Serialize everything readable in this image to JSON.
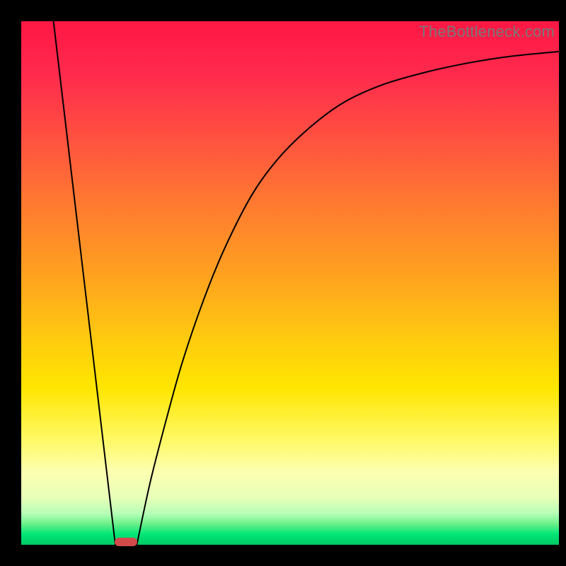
{
  "watermark": "TheBottleneck.com",
  "colors": {
    "background": "#000000",
    "curve": "#000000",
    "marker": "#d24a4a",
    "gradient_top": "#ff1744",
    "gradient_bottom": "#00c864"
  },
  "chart_data": {
    "type": "line",
    "title": "",
    "xlabel": "",
    "ylabel": "",
    "xlim": [
      0,
      1
    ],
    "ylim": [
      0,
      1
    ],
    "annotations": [
      "TheBottleneck.com"
    ],
    "left_segment": {
      "start": {
        "x": 0.06,
        "y": 1.0
      },
      "end": {
        "x": 0.175,
        "y": 0.0
      }
    },
    "right_segment": {
      "points": [
        {
          "x": 0.215,
          "y": 0.0
        },
        {
          "x": 0.24,
          "y": 0.12
        },
        {
          "x": 0.27,
          "y": 0.24
        },
        {
          "x": 0.3,
          "y": 0.35
        },
        {
          "x": 0.34,
          "y": 0.47
        },
        {
          "x": 0.38,
          "y": 0.57
        },
        {
          "x": 0.43,
          "y": 0.67
        },
        {
          "x": 0.48,
          "y": 0.74
        },
        {
          "x": 0.54,
          "y": 0.8
        },
        {
          "x": 0.6,
          "y": 0.845
        },
        {
          "x": 0.67,
          "y": 0.878
        },
        {
          "x": 0.75,
          "y": 0.902
        },
        {
          "x": 0.83,
          "y": 0.92
        },
        {
          "x": 0.91,
          "y": 0.933
        },
        {
          "x": 1.0,
          "y": 0.942
        }
      ]
    },
    "marker": {
      "x": 0.195,
      "y": 0.005
    }
  }
}
